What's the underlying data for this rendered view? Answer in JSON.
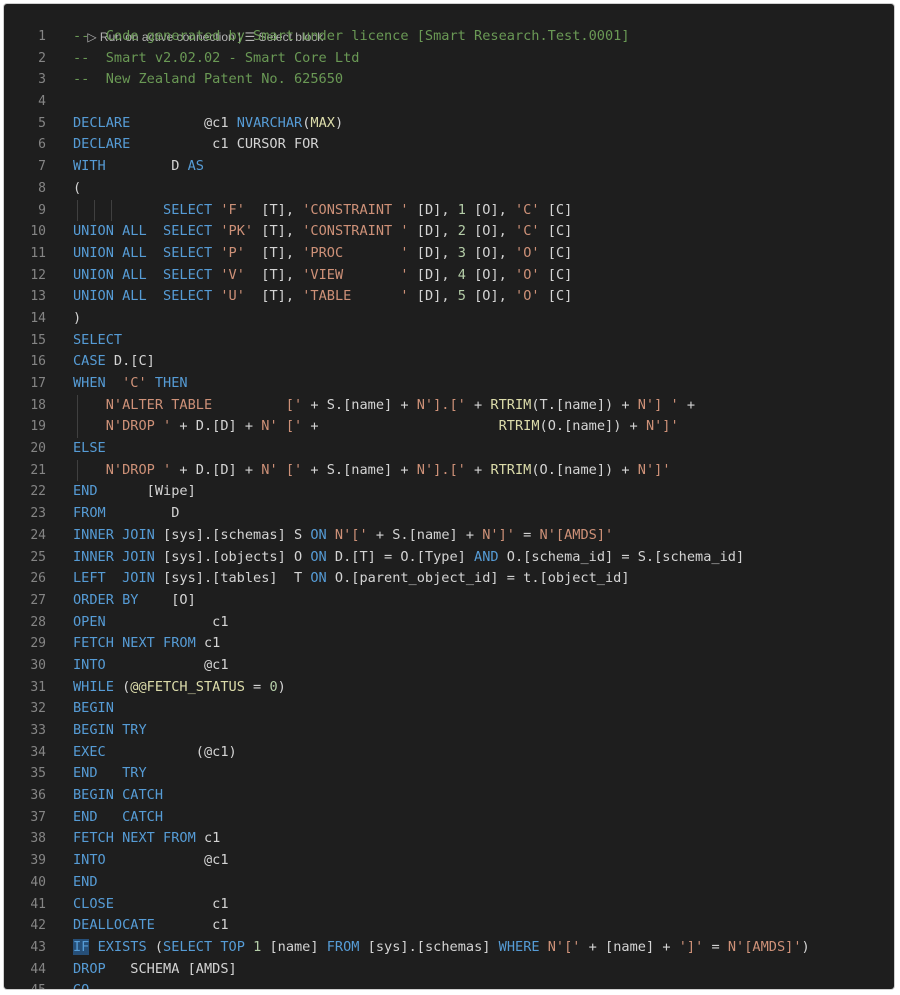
{
  "codelens": {
    "run_label": "▷ Run on active connection",
    "separator": " | ",
    "select_label": "☰ Select block"
  },
  "theme": {
    "background": "#1e1e1e",
    "keyword": "#569cd6",
    "string": "#ce9178",
    "number": "#b5cea8",
    "function": "#dcdcaa",
    "comment": "#6a9955",
    "line_number": "#858585"
  },
  "lines": [
    {
      "n": "1",
      "tokens": [
        {
          "t": "com",
          "v": "--  Code generated by Smart under licence [Smart Research.Test.0001]"
        }
      ]
    },
    {
      "n": "2",
      "tokens": [
        {
          "t": "com",
          "v": "--  Smart v2.02.02 - Smart Core Ltd"
        }
      ]
    },
    {
      "n": "3",
      "tokens": [
        {
          "t": "com",
          "v": "--  New Zealand Patent No. 625650"
        }
      ]
    },
    {
      "n": "4",
      "tokens": []
    },
    {
      "n": "5",
      "tokens": [
        {
          "t": "kw",
          "v": "DECLARE"
        },
        {
          "t": "ws",
          "v": "         "
        },
        {
          "t": "id",
          "v": "@c1 "
        },
        {
          "t": "kw",
          "v": "NVARCHAR"
        },
        {
          "t": "op",
          "v": "("
        },
        {
          "t": "fn",
          "v": "MAX"
        },
        {
          "t": "op",
          "v": ")"
        }
      ]
    },
    {
      "n": "6",
      "tokens": [
        {
          "t": "kw",
          "v": "DECLARE"
        },
        {
          "t": "ws",
          "v": "          "
        },
        {
          "t": "id",
          "v": "c1 CURSOR FOR"
        }
      ]
    },
    {
      "n": "7",
      "tokens": [
        {
          "t": "kw",
          "v": "WITH"
        },
        {
          "t": "ws",
          "v": "        "
        },
        {
          "t": "id",
          "v": "D "
        },
        {
          "t": "kw",
          "v": "AS"
        }
      ]
    },
    {
      "n": "8",
      "tokens": [
        {
          "t": "op",
          "v": "("
        }
      ]
    },
    {
      "n": "9",
      "guides": [
        1,
        2,
        3
      ],
      "tokens": [
        {
          "t": "ws",
          "v": "           "
        },
        {
          "t": "kw",
          "v": "SELECT"
        },
        {
          "t": "ws",
          "v": " "
        },
        {
          "t": "str",
          "v": "'F'"
        },
        {
          "t": "ws",
          "v": "  "
        },
        {
          "t": "id",
          "v": "[T], "
        },
        {
          "t": "str",
          "v": "'CONSTRAINT '"
        },
        {
          "t": "id",
          "v": " [D], "
        },
        {
          "t": "num",
          "v": "1"
        },
        {
          "t": "id",
          "v": " [O], "
        },
        {
          "t": "str",
          "v": "'C'"
        },
        {
          "t": "id",
          "v": " [C]"
        }
      ]
    },
    {
      "n": "10",
      "tokens": [
        {
          "t": "kw",
          "v": "UNION ALL"
        },
        {
          "t": "ws",
          "v": "  "
        },
        {
          "t": "kw",
          "v": "SELECT"
        },
        {
          "t": "ws",
          "v": " "
        },
        {
          "t": "str",
          "v": "'PK'"
        },
        {
          "t": "id",
          "v": " [T], "
        },
        {
          "t": "str",
          "v": "'CONSTRAINT '"
        },
        {
          "t": "id",
          "v": " [D], "
        },
        {
          "t": "num",
          "v": "2"
        },
        {
          "t": "id",
          "v": " [O], "
        },
        {
          "t": "str",
          "v": "'C'"
        },
        {
          "t": "id",
          "v": " [C]"
        }
      ]
    },
    {
      "n": "11",
      "tokens": [
        {
          "t": "kw",
          "v": "UNION ALL"
        },
        {
          "t": "ws",
          "v": "  "
        },
        {
          "t": "kw",
          "v": "SELECT"
        },
        {
          "t": "ws",
          "v": " "
        },
        {
          "t": "str",
          "v": "'P'"
        },
        {
          "t": "id",
          "v": "  [T], "
        },
        {
          "t": "str",
          "v": "'PROC       '"
        },
        {
          "t": "id",
          "v": " [D], "
        },
        {
          "t": "num",
          "v": "3"
        },
        {
          "t": "id",
          "v": " [O], "
        },
        {
          "t": "str",
          "v": "'O'"
        },
        {
          "t": "id",
          "v": " [C]"
        }
      ]
    },
    {
      "n": "12",
      "tokens": [
        {
          "t": "kw",
          "v": "UNION ALL"
        },
        {
          "t": "ws",
          "v": "  "
        },
        {
          "t": "kw",
          "v": "SELECT"
        },
        {
          "t": "ws",
          "v": " "
        },
        {
          "t": "str",
          "v": "'V'"
        },
        {
          "t": "id",
          "v": "  [T], "
        },
        {
          "t": "str",
          "v": "'VIEW       '"
        },
        {
          "t": "id",
          "v": " [D], "
        },
        {
          "t": "num",
          "v": "4"
        },
        {
          "t": "id",
          "v": " [O], "
        },
        {
          "t": "str",
          "v": "'O'"
        },
        {
          "t": "id",
          "v": " [C]"
        }
      ]
    },
    {
      "n": "13",
      "tokens": [
        {
          "t": "kw",
          "v": "UNION ALL"
        },
        {
          "t": "ws",
          "v": "  "
        },
        {
          "t": "kw",
          "v": "SELECT"
        },
        {
          "t": "ws",
          "v": " "
        },
        {
          "t": "str",
          "v": "'U'"
        },
        {
          "t": "id",
          "v": "  [T], "
        },
        {
          "t": "str",
          "v": "'TABLE      '"
        },
        {
          "t": "id",
          "v": " [D], "
        },
        {
          "t": "num",
          "v": "5"
        },
        {
          "t": "id",
          "v": " [O], "
        },
        {
          "t": "str",
          "v": "'O'"
        },
        {
          "t": "id",
          "v": " [C]"
        }
      ]
    },
    {
      "n": "14",
      "tokens": [
        {
          "t": "op",
          "v": ")"
        }
      ]
    },
    {
      "n": "15",
      "tokens": [
        {
          "t": "kw",
          "v": "SELECT"
        }
      ]
    },
    {
      "n": "16",
      "tokens": [
        {
          "t": "kw",
          "v": "CASE"
        },
        {
          "t": "id",
          "v": " D.[C]"
        }
      ]
    },
    {
      "n": "17",
      "tokens": [
        {
          "t": "kw",
          "v": "WHEN"
        },
        {
          "t": "ws",
          "v": "  "
        },
        {
          "t": "str",
          "v": "'C'"
        },
        {
          "t": "ws",
          "v": " "
        },
        {
          "t": "kw",
          "v": "THEN"
        }
      ]
    },
    {
      "n": "18",
      "guides": [
        1
      ],
      "tokens": [
        {
          "t": "ws",
          "v": "    "
        },
        {
          "t": "str",
          "v": "N'ALTER TABLE         ['"
        },
        {
          "t": "id",
          "v": " + S.[name] + "
        },
        {
          "t": "str",
          "v": "N'].['"
        },
        {
          "t": "id",
          "v": " + "
        },
        {
          "t": "fn",
          "v": "RTRIM"
        },
        {
          "t": "id",
          "v": "(T.[name]) + "
        },
        {
          "t": "str",
          "v": "N'] '"
        },
        {
          "t": "id",
          "v": " +"
        }
      ]
    },
    {
      "n": "19",
      "guides": [
        1
      ],
      "tokens": [
        {
          "t": "ws",
          "v": "    "
        },
        {
          "t": "str",
          "v": "N'DROP '"
        },
        {
          "t": "id",
          "v": " + D.[D] + "
        },
        {
          "t": "str",
          "v": "N' ['"
        },
        {
          "t": "id",
          "v": " +                      "
        },
        {
          "t": "fn",
          "v": "RTRIM"
        },
        {
          "t": "id",
          "v": "(O.[name]) + "
        },
        {
          "t": "str",
          "v": "N']'"
        }
      ]
    },
    {
      "n": "20",
      "tokens": [
        {
          "t": "kw",
          "v": "ELSE"
        }
      ]
    },
    {
      "n": "21",
      "guides": [
        1
      ],
      "tokens": [
        {
          "t": "ws",
          "v": "    "
        },
        {
          "t": "str",
          "v": "N'DROP '"
        },
        {
          "t": "id",
          "v": " + D.[D] + "
        },
        {
          "t": "str",
          "v": "N' ['"
        },
        {
          "t": "id",
          "v": " + S.[name] + "
        },
        {
          "t": "str",
          "v": "N'].['"
        },
        {
          "t": "id",
          "v": " + "
        },
        {
          "t": "fn",
          "v": "RTRIM"
        },
        {
          "t": "id",
          "v": "(O.[name]) + "
        },
        {
          "t": "str",
          "v": "N']'"
        }
      ]
    },
    {
      "n": "22",
      "tokens": [
        {
          "t": "kw",
          "v": "END"
        },
        {
          "t": "id",
          "v": "      [Wipe]"
        }
      ]
    },
    {
      "n": "23",
      "tokens": [
        {
          "t": "kw",
          "v": "FROM"
        },
        {
          "t": "id",
          "v": "        D"
        }
      ]
    },
    {
      "n": "24",
      "tokens": [
        {
          "t": "kw",
          "v": "INNER JOIN"
        },
        {
          "t": "id",
          "v": " [sys].[schemas] S "
        },
        {
          "t": "kw",
          "v": "ON"
        },
        {
          "t": "ws",
          "v": " "
        },
        {
          "t": "str",
          "v": "N'['"
        },
        {
          "t": "id",
          "v": " + S.[name] + "
        },
        {
          "t": "str",
          "v": "N']'"
        },
        {
          "t": "id",
          "v": " = "
        },
        {
          "t": "str",
          "v": "N'[AMDS]'"
        }
      ]
    },
    {
      "n": "25",
      "tokens": [
        {
          "t": "kw",
          "v": "INNER JOIN"
        },
        {
          "t": "id",
          "v": " [sys].[objects] O "
        },
        {
          "t": "kw",
          "v": "ON"
        },
        {
          "t": "id",
          "v": " D.[T] = O.[Type] "
        },
        {
          "t": "kw",
          "v": "AND"
        },
        {
          "t": "id",
          "v": " O.[schema_id] = S.[schema_id]"
        }
      ]
    },
    {
      "n": "26",
      "tokens": [
        {
          "t": "kw",
          "v": "LEFT  JOIN"
        },
        {
          "t": "id",
          "v": " [sys].[tables]  T "
        },
        {
          "t": "kw",
          "v": "ON"
        },
        {
          "t": "id",
          "v": " O.[parent_object_id] = t.[object_id]"
        }
      ]
    },
    {
      "n": "27",
      "tokens": [
        {
          "t": "kw",
          "v": "ORDER BY"
        },
        {
          "t": "id",
          "v": "    [O]"
        }
      ]
    },
    {
      "n": "28",
      "tokens": [
        {
          "t": "kw",
          "v": "OPEN"
        },
        {
          "t": "id",
          "v": "             c1"
        }
      ]
    },
    {
      "n": "29",
      "tokens": [
        {
          "t": "kw",
          "v": "FETCH NEXT FROM"
        },
        {
          "t": "id",
          "v": " c1"
        }
      ]
    },
    {
      "n": "30",
      "tokens": [
        {
          "t": "kw",
          "v": "INTO"
        },
        {
          "t": "id",
          "v": "            @c1"
        }
      ]
    },
    {
      "n": "31",
      "tokens": [
        {
          "t": "kw",
          "v": "WHILE"
        },
        {
          "t": "id",
          "v": " ("
        },
        {
          "t": "fn",
          "v": "@@FETCH_STATUS"
        },
        {
          "t": "id",
          "v": " = "
        },
        {
          "t": "num",
          "v": "0"
        },
        {
          "t": "id",
          "v": ")"
        }
      ]
    },
    {
      "n": "32",
      "tokens": [
        {
          "t": "kw",
          "v": "BEGIN"
        }
      ]
    },
    {
      "n": "33",
      "tokens": [
        {
          "t": "kw",
          "v": "BEGIN TRY"
        }
      ]
    },
    {
      "n": "34",
      "tokens": [
        {
          "t": "kw",
          "v": "EXEC"
        },
        {
          "t": "id",
          "v": "           (@c1)"
        }
      ]
    },
    {
      "n": "35",
      "tokens": [
        {
          "t": "kw",
          "v": "END   TRY"
        }
      ]
    },
    {
      "n": "36",
      "tokens": [
        {
          "t": "kw",
          "v": "BEGIN CATCH"
        }
      ]
    },
    {
      "n": "37",
      "tokens": [
        {
          "t": "kw",
          "v": "END   CATCH"
        }
      ]
    },
    {
      "n": "38",
      "tokens": [
        {
          "t": "kw",
          "v": "FETCH NEXT FROM"
        },
        {
          "t": "id",
          "v": " c1"
        }
      ]
    },
    {
      "n": "39",
      "tokens": [
        {
          "t": "kw",
          "v": "INTO"
        },
        {
          "t": "id",
          "v": "            @c1"
        }
      ]
    },
    {
      "n": "40",
      "tokens": [
        {
          "t": "kw",
          "v": "END"
        }
      ]
    },
    {
      "n": "41",
      "tokens": [
        {
          "t": "kw",
          "v": "CLOSE"
        },
        {
          "t": "id",
          "v": "            c1"
        }
      ]
    },
    {
      "n": "42",
      "tokens": [
        {
          "t": "kw",
          "v": "DEALLOCATE"
        },
        {
          "t": "id",
          "v": "       c1"
        }
      ]
    },
    {
      "n": "43",
      "tokens": [
        {
          "t": "hl",
          "v": "IF"
        },
        {
          "t": "ws",
          "v": " "
        },
        {
          "t": "kw",
          "v": "EXISTS"
        },
        {
          "t": "id",
          "v": " ("
        },
        {
          "t": "kw",
          "v": "SELECT TOP"
        },
        {
          "t": "ws",
          "v": " "
        },
        {
          "t": "num",
          "v": "1"
        },
        {
          "t": "id",
          "v": " [name] "
        },
        {
          "t": "kw",
          "v": "FROM"
        },
        {
          "t": "id",
          "v": " [sys].[schemas] "
        },
        {
          "t": "kw",
          "v": "WHERE"
        },
        {
          "t": "ws",
          "v": " "
        },
        {
          "t": "str",
          "v": "N'['"
        },
        {
          "t": "id",
          "v": " + [name] + "
        },
        {
          "t": "str",
          "v": "']'"
        },
        {
          "t": "id",
          "v": " = "
        },
        {
          "t": "str",
          "v": "N'[AMDS]'"
        },
        {
          "t": "id",
          "v": ")"
        }
      ]
    },
    {
      "n": "44",
      "tokens": [
        {
          "t": "kw",
          "v": "DROP"
        },
        {
          "t": "id",
          "v": "   SCHEMA [AMDS]"
        }
      ]
    },
    {
      "n": "45",
      "tokens": [
        {
          "t": "kw",
          "v": "GO"
        }
      ]
    }
  ]
}
